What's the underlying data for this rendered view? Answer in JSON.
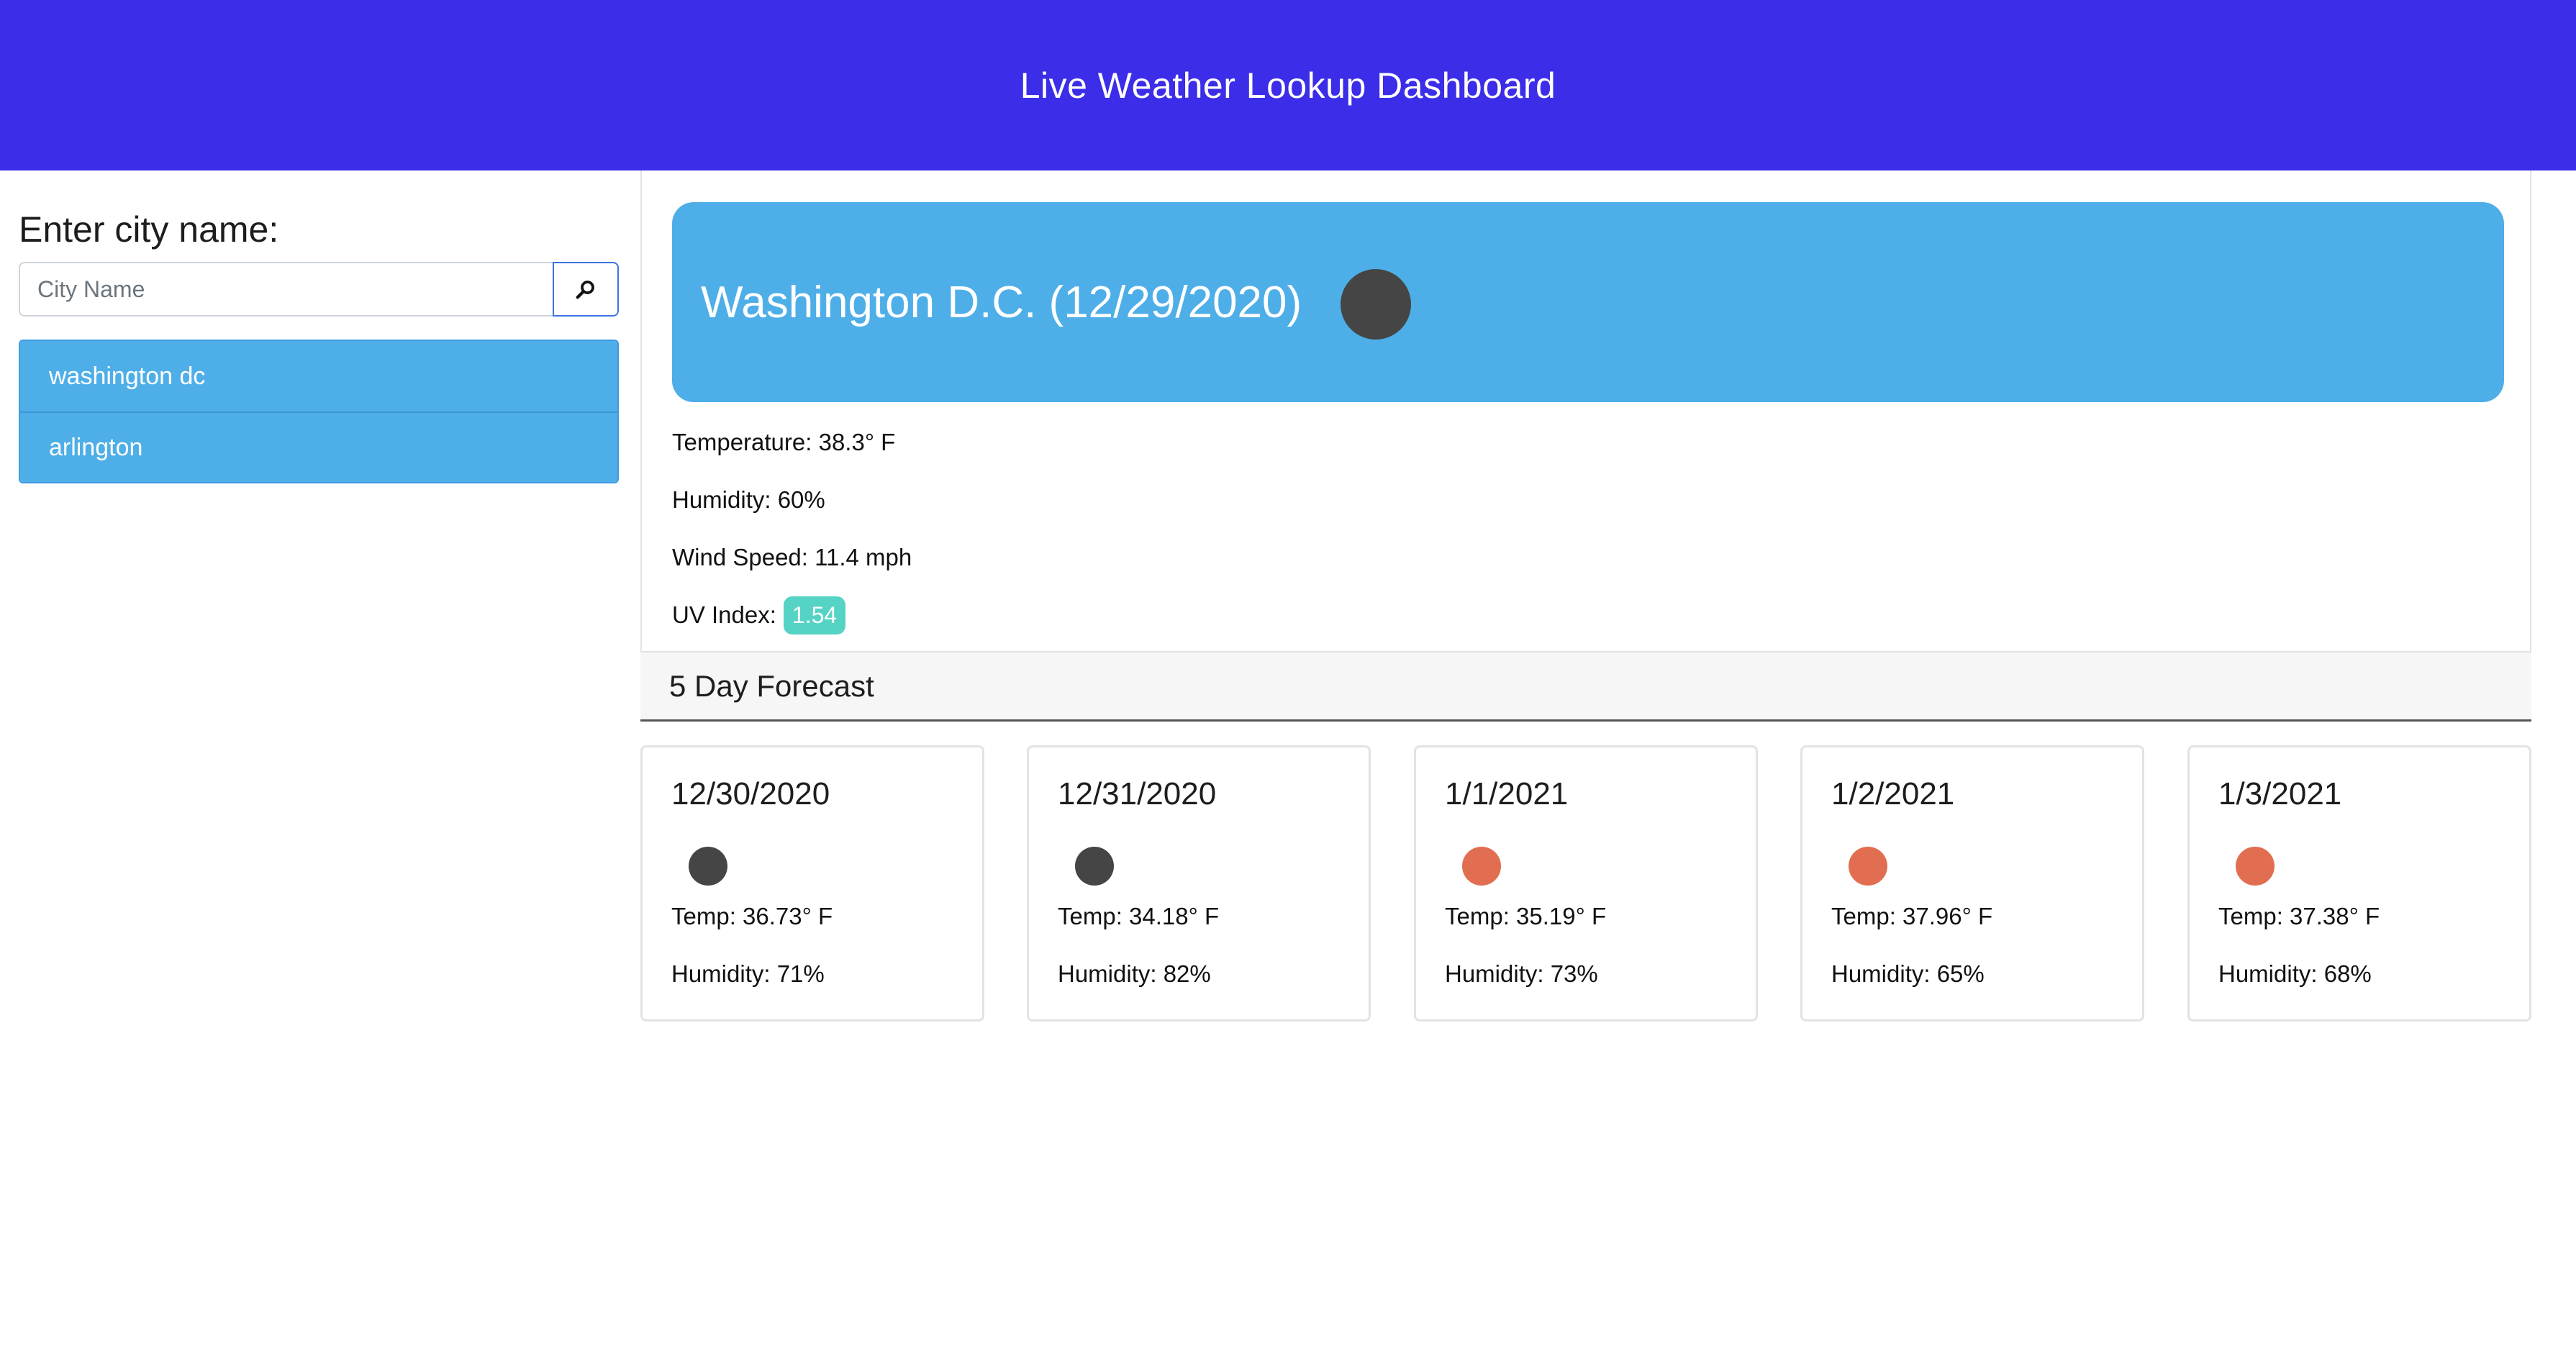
{
  "header": {
    "title": "Live Weather Lookup Dashboard",
    "background_color": "#3b2de8"
  },
  "sidebar": {
    "heading": "Enter city name:",
    "search": {
      "placeholder": "City Name",
      "value": "",
      "button_icon": "search-icon"
    },
    "history": [
      {
        "label": "washington dc"
      },
      {
        "label": "arlington"
      }
    ],
    "history_color": "#4eaee8"
  },
  "current": {
    "title": "Washington D.C. (12/29/2020)",
    "icon": "weather-icon",
    "icon_color": "#454545",
    "banner_color": "#4eaee8",
    "temperature": "Temperature: 38.3° F",
    "humidity": "Humidity: 60%",
    "wind": "Wind Speed: 11.4 mph",
    "uv_label": "UV Index:",
    "uv_value": "1.54",
    "uv_color": "#55d3c4"
  },
  "forecast": {
    "title": "5 Day Forecast",
    "days": [
      {
        "date": "12/30/2020",
        "icon_color": "#454545",
        "temp": "Temp: 36.73° F",
        "humidity": "Humidity: 71%"
      },
      {
        "date": "12/31/2020",
        "icon_color": "#454545",
        "temp": "Temp: 34.18° F",
        "humidity": "Humidity: 82%"
      },
      {
        "date": "1/1/2021",
        "icon_color": "#e16e50",
        "temp": "Temp: 35.19° F",
        "humidity": "Humidity: 73%"
      },
      {
        "date": "1/2/2021",
        "icon_color": "#e16e50",
        "temp": "Temp: 37.96° F",
        "humidity": "Humidity: 65%"
      },
      {
        "date": "1/3/2021",
        "icon_color": "#e16e50",
        "temp": "Temp: 37.38° F",
        "humidity": "Humidity: 68%"
      }
    ]
  }
}
